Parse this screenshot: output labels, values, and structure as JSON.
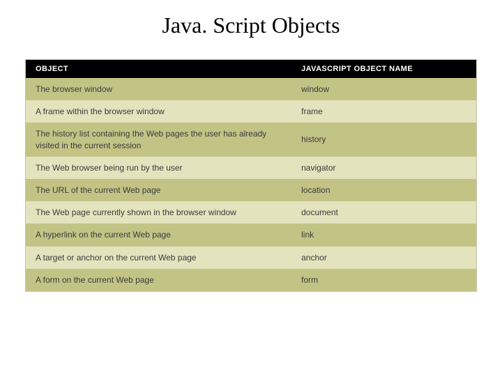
{
  "title": "Java. Script Objects",
  "chart_data": {
    "type": "table",
    "columns": [
      "OBJECT",
      "JAVASCRIPT OBJECT NAME"
    ],
    "rows": [
      {
        "object": "The browser window",
        "name": "window"
      },
      {
        "object": "A frame within the browser window",
        "name": "frame"
      },
      {
        "object": "The history list containing the Web pages the user has already visited in the current session",
        "name": "history"
      },
      {
        "object": "The Web browser being run by the user",
        "name": "navigator"
      },
      {
        "object": "The URL of the current Web page",
        "name": "location"
      },
      {
        "object": "The Web page currently shown in the browser window",
        "name": "document"
      },
      {
        "object": "A hyperlink on the current Web page",
        "name": "link"
      },
      {
        "object": "A target or anchor on the current Web page",
        "name": "anchor"
      },
      {
        "object": "A form on the current Web page",
        "name": "form"
      }
    ]
  }
}
